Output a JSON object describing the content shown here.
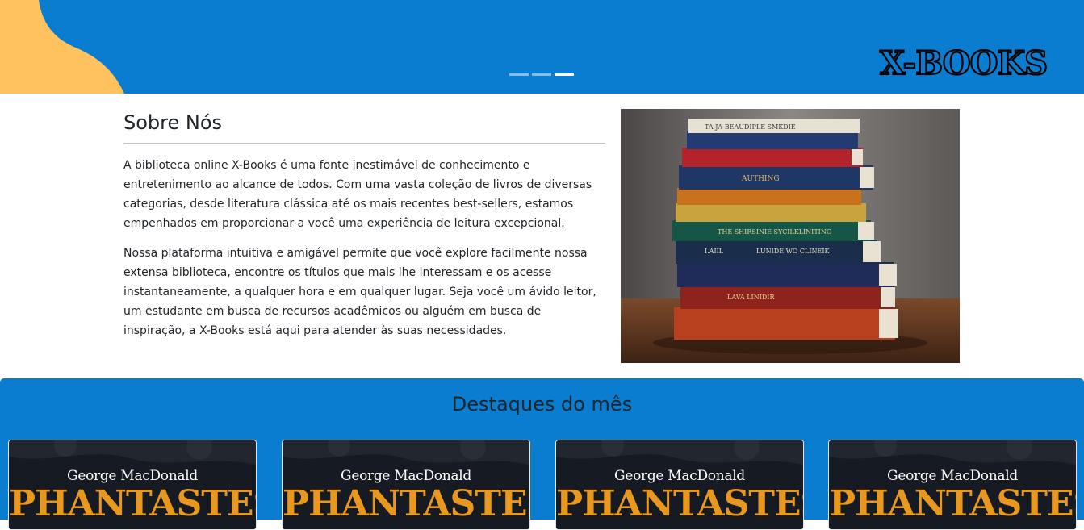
{
  "colors": {
    "primary": "#0a7dd0",
    "accent_blob": "#ffc25e",
    "text": "#212529",
    "card_title": "#e8971f"
  },
  "hero": {
    "brand": "X-BOOKS",
    "carousel_slide_count": 3,
    "carousel_active_index": 2
  },
  "about": {
    "title": "Sobre Nós",
    "paragraphs": [
      "A biblioteca online X-Books é uma fonte inestimável de conhecimento e entretenimento ao alcance de todos. Com uma vasta coleção de livros de diversas categorias, desde literatura clássica até os mais recentes best-sellers, estamos empenhados em proporcionar a você uma experiência de leitura excepcional.",
      "Nossa plataforma intuitiva e amigável permite que você explore facilmente nossa extensa biblioteca, encontre os títulos que mais lhe interessam e os acesse instantaneamente, a qualquer hora e em qualquer lugar. Seja você um ávido leitor, um estudante em busca de recursos acadêmicos ou alguém em busca de inspiração, a X-Books está aqui para atender às suas necessidades."
    ],
    "image_icon": "stack-of-books-photo"
  },
  "highlights": {
    "title": "Destaques do mês",
    "books": [
      {
        "author": "George MacDonald",
        "title": "PHANTASTES"
      },
      {
        "author": "George MacDonald",
        "title": "PHANTASTES"
      },
      {
        "author": "George MacDonald",
        "title": "PHANTASTES"
      },
      {
        "author": "George MacDonald",
        "title": "PHANTASTES"
      }
    ]
  }
}
